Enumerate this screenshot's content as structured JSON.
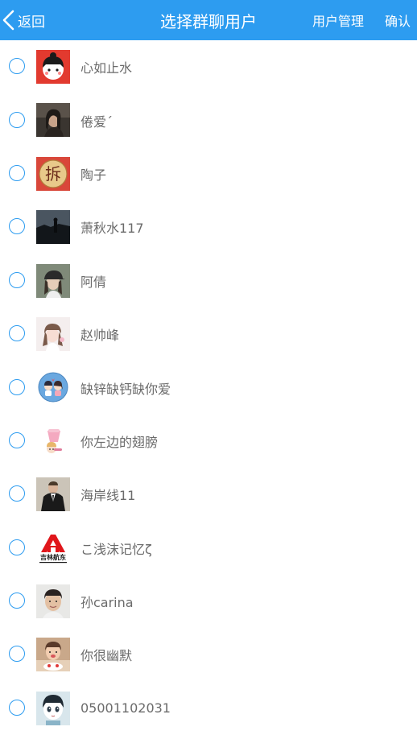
{
  "header": {
    "back_label": "返回",
    "title": "选择群聊用户",
    "manage_label": "用户管理",
    "confirm_label": "确认",
    "background": "#2d9cf0",
    "back_icon": "chevron-left-icon"
  },
  "accent": "#2d9cf0",
  "contacts": [
    {
      "name": "心如止水",
      "avatar": "cartoon-girl-red"
    },
    {
      "name": "倦爱ˊ",
      "avatar": "photo-dark-woman"
    },
    {
      "name": "陶子",
      "avatar": "stamp-chai",
      "avatar_text": "拆"
    },
    {
      "name": "萧秋水117",
      "avatar": "photo-dark-scene"
    },
    {
      "name": "阿倩",
      "avatar": "photo-cap-woman"
    },
    {
      "name": "赵帅峰",
      "avatar": "photo-light-girl"
    },
    {
      "name": "缺锌缺钙缺你爱",
      "avatar": "cartoon-couple-blue"
    },
    {
      "name": "你左边的翅膀",
      "avatar": "cartoon-pink"
    },
    {
      "name": "海岸线11",
      "avatar": "photo-man-suit"
    },
    {
      "name": "こ浅沫记忆ζ",
      "avatar": "logo-jilin",
      "avatar_text": "吉林航东"
    },
    {
      "name": "孙carina",
      "avatar": "photo-boy"
    },
    {
      "name": "你很幽默",
      "avatar": "photo-child"
    },
    {
      "name": "05001102031",
      "avatar": "cartoon-doll"
    }
  ]
}
